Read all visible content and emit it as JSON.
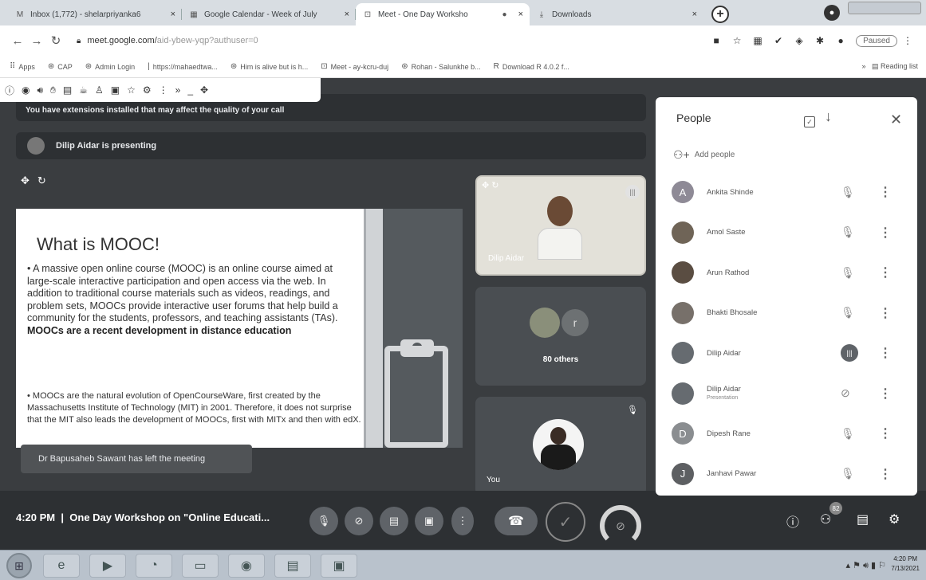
{
  "browser": {
    "tabs": [
      {
        "icon": "M",
        "title": "Inbox (1,772) - shelarpriyanka6",
        "close": "×"
      },
      {
        "icon": "▦",
        "title": "Google Calendar - Week of July",
        "close": "×"
      },
      {
        "icon": "⊡",
        "title": "Meet - One Day Worksho",
        "close": "×"
      },
      {
        "icon": "⤓",
        "title": "Downloads",
        "close": "×"
      }
    ],
    "new_tab": "+",
    "url": "meet.google.com/",
    "url_rest": "aid-ybew-yqp?authuser=0",
    "paused_label": "Paused",
    "bookmarks": [
      {
        "icon": "⠿",
        "label": "Apps"
      },
      {
        "icon": "⊛",
        "label": "CAP"
      },
      {
        "icon": "⊛",
        "label": "Admin Login"
      },
      {
        "icon": "|",
        "label": "https://mahaedtwa..."
      },
      {
        "icon": "⊛",
        "label": "Him is alive but is h..."
      },
      {
        "icon": "⊡",
        "label": "Meet - ay-kcru-duj"
      },
      {
        "icon": "⊛",
        "label": "Rohan - Salunkhe b..."
      },
      {
        "icon": "R",
        "label": "Download R 4.0.2 f..."
      }
    ],
    "reading_list": "Reading list"
  },
  "meet": {
    "warning": "You have extensions installed that may affect the quality of your call",
    "presenting": "Dilip Aidar is presenting",
    "slide": {
      "title": "What is MOOC!",
      "para1": "• A massive open online course (MOOC) is an online course aimed at large-scale interactive participation and open access via the web. In addition to traditional course materials such as videos, readings, and problem sets, MOOCs provide interactive user forums that help build a community for the students, professors, and teaching assistants (TAs).",
      "para1_bold": "MOOCs are a recent development in distance education",
      "para2": "• MOOCs are the natural evolution of OpenCourseWare, first created by the Massachusetts Institute of Technology (MIT) in 2001. Therefore, it does not surprise that the MIT also leads the development of MOOCs, first with MITx and then with edX."
    },
    "toast": "Dr Bapusaheb Sawant has left the meeting",
    "tiles": {
      "presenter_name": "Dilip Aidar",
      "others_initial": "r",
      "others_label": "80 others",
      "you_label": "You"
    },
    "clock": "4:20 PM",
    "meeting_title": "One Day Workshop on \"Online Educati...",
    "people_badge": "82"
  },
  "people_panel": {
    "title": "People",
    "add_people": "Add people",
    "participants": [
      {
        "initial": "A",
        "name": "Ankita Shinde",
        "sub": "",
        "status": "mic-off",
        "color": "#8e8a96"
      },
      {
        "initial": "",
        "name": "Amol Saste",
        "sub": "",
        "status": "mic-off",
        "color": "#6f6457"
      },
      {
        "initial": "",
        "name": "Arun Rathod",
        "sub": "",
        "status": "mic-off",
        "color": "#5a4d42"
      },
      {
        "initial": "",
        "name": "Bhakti Bhosale",
        "sub": "",
        "status": "mic-off",
        "color": "#77706a"
      },
      {
        "initial": "",
        "name": "Dilip Aidar",
        "sub": "",
        "status": "speaking",
        "color": "#666b70"
      },
      {
        "initial": "",
        "name": "Dilip Aidar",
        "sub": "Presentation",
        "status": "present-off",
        "color": "#666b70"
      },
      {
        "initial": "D",
        "name": "Dipesh Rane",
        "sub": "",
        "status": "mic-off",
        "color": "#8a8d90"
      },
      {
        "initial": "J",
        "name": "Janhavi Pawar",
        "sub": "",
        "status": "mic-off",
        "color": "#5d5f62"
      }
    ]
  },
  "taskbar": {
    "time": "4:20 PM",
    "date": "7/13/2021"
  }
}
